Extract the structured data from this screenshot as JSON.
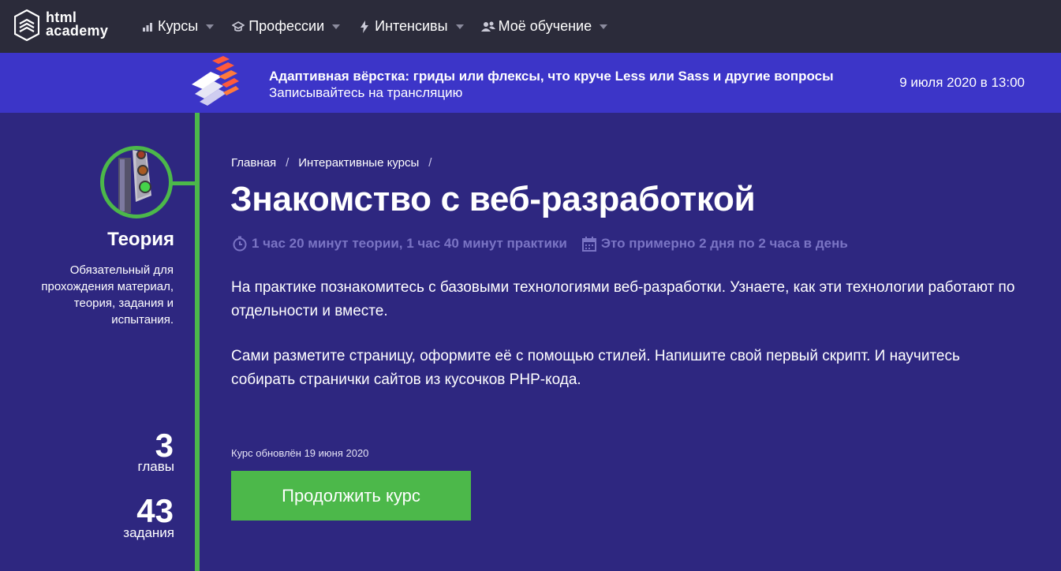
{
  "header": {
    "logo_text_line1": "html",
    "logo_text_line2": "academy",
    "nav": [
      {
        "label": "Курсы",
        "icon": "bar-chart-icon"
      },
      {
        "label": "Профессии",
        "icon": "graduation-cap-icon"
      },
      {
        "label": "Интенсивы",
        "icon": "lightning-icon"
      },
      {
        "label": "Моё обучение",
        "icon": "users-icon"
      }
    ]
  },
  "banner": {
    "title": "Адаптивная вёрстка: гриды или флексы, что круче Less или Sass и другие вопросы",
    "subtitle": "Записывайтесь на трансляцию",
    "date": "9 июля 2020 в 13:00"
  },
  "sidebar": {
    "section_title": "Теория",
    "description": "Обязательный для прохождения материал, теория, задания и испытания.",
    "stats": [
      {
        "value": "3",
        "label": "главы"
      },
      {
        "value": "43",
        "label": "задания"
      }
    ]
  },
  "main": {
    "breadcrumbs": [
      "Главная",
      "Интерактивные курсы"
    ],
    "title": "Знакомство с веб-разработкой",
    "duration": "1 час 20 минут теории, 1 час 40 минут практики",
    "schedule": "Это примерно 2 дня по 2 часа в день",
    "paragraph1": "На практике познакомитесь с базовыми технологиями веб-разработки. Узнаете, как эти технологии работают по отдельности и вместе.",
    "paragraph2": "Сами разметите страницу, оформите её с помощью стилей. Напишите свой первый скрипт. И научитесь собирать странички сайтов из кусочков PHP-кода.",
    "updated": "Курс обновлён 19 июня 2020",
    "cta_label": "Продолжить курс"
  },
  "colors": {
    "background": "#2e2780",
    "header": "#2b2b3a",
    "banner": "#3c35c8",
    "accent_green": "#4cb84a",
    "meta_text": "#7a74c4"
  }
}
